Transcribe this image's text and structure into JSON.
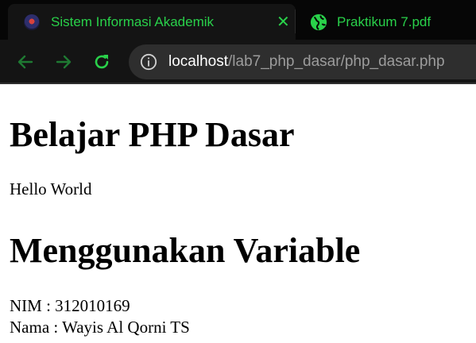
{
  "browser": {
    "tabs": [
      {
        "title": "Sistem Informasi Akademik",
        "active": true,
        "close_symbol": "✕"
      },
      {
        "title": "Praktikum 7.pdf",
        "active": false
      }
    ],
    "url_host": "localhost",
    "url_path": "/lab7_php_dasar/php_dasar.php",
    "accent_color": "#29d14a"
  },
  "page": {
    "heading1": "Belajar PHP Dasar",
    "hello": "Hello World",
    "heading2": "Menggunakan Variable",
    "nim_line": "NIM : 312010169",
    "nama_line": "Nama : Wayis Al Qorni TS"
  }
}
